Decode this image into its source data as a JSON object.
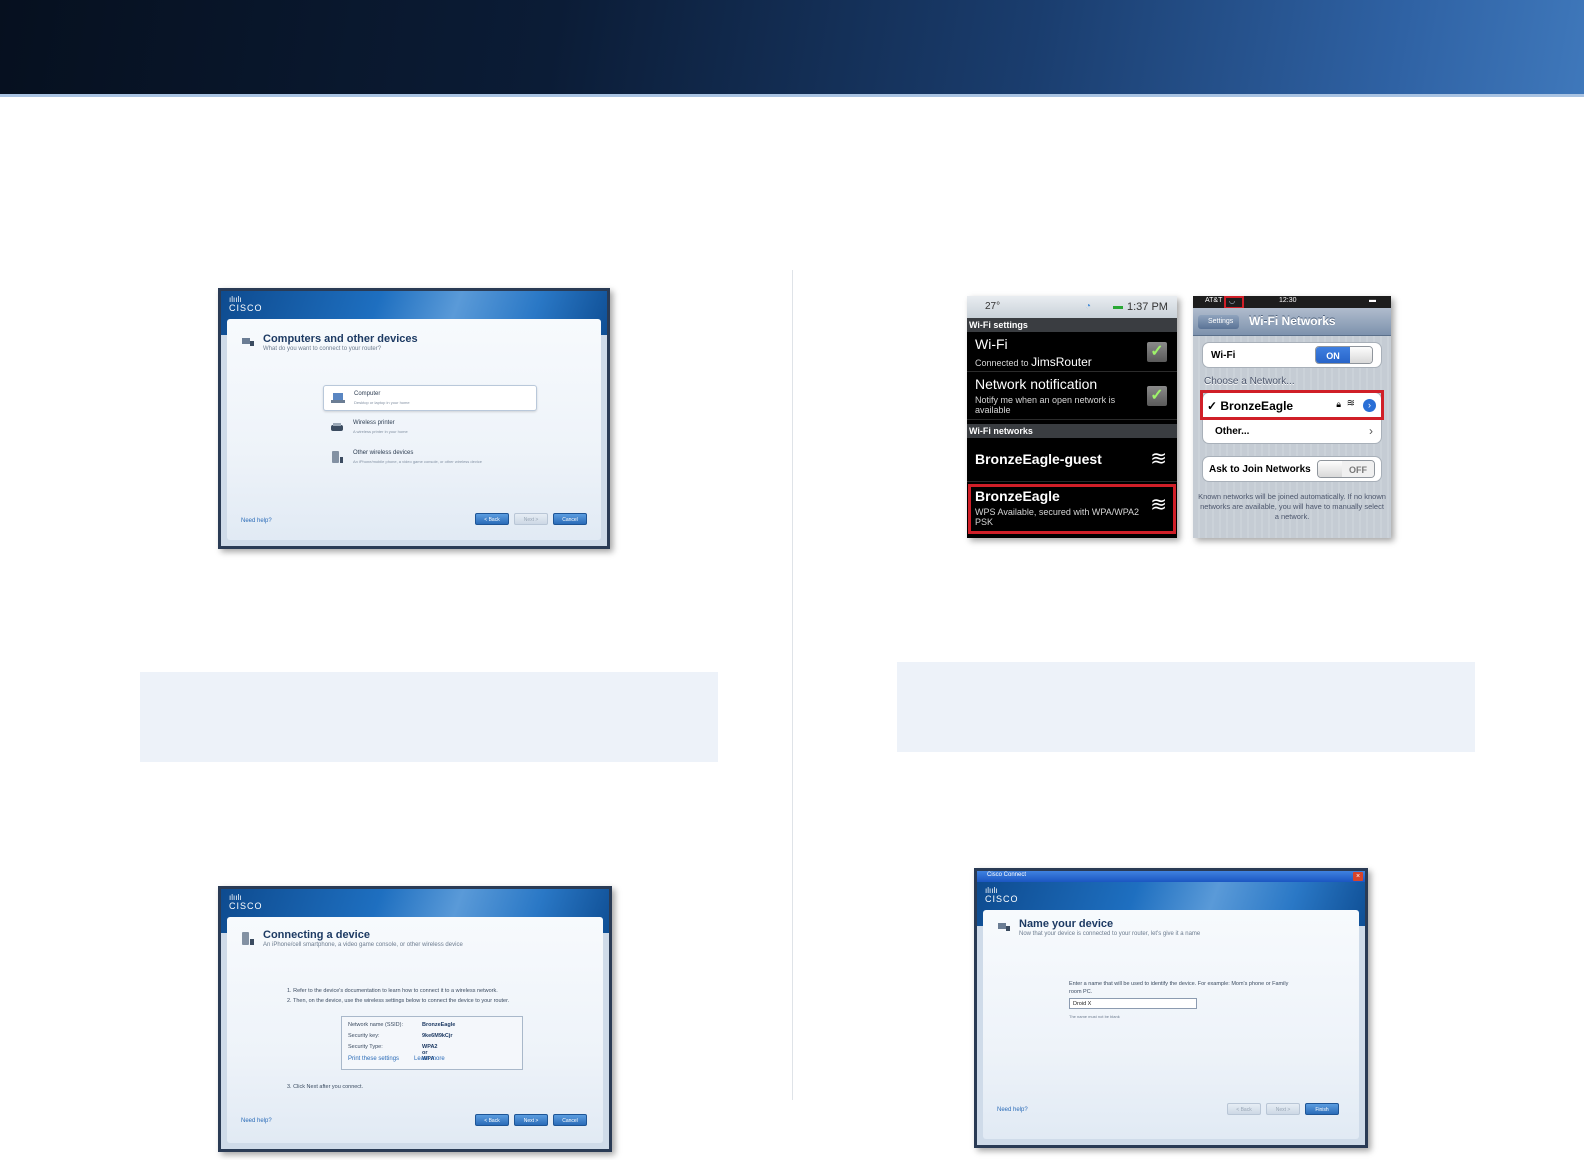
{
  "window_left": {
    "title": "Computers and other devices",
    "subtitle": "What do you want to connect to your router?",
    "options": [
      {
        "title": "Computer",
        "desc": "Desktop or laptop in your home"
      },
      {
        "title": "Wireless printer",
        "desc": "A wireless printer in your home"
      },
      {
        "title": "Other wireless devices",
        "desc": "An iPhone/mobile phone, a video game console, or other wireless device"
      }
    ],
    "help": "Need help?",
    "buttons": {
      "back": "< Back",
      "next": "Next >",
      "cancel": "Cancel"
    }
  },
  "window_connect": {
    "title": "Connecting a device",
    "subtitle": "An iPhone/cell smartphone, a video game console, or other wireless device",
    "steps": [
      "1.  Refer to the device's documentation to learn how to connect it to a wireless network.",
      "2.  Then, on the device, use the wireless settings below to connect the device to your router.",
      "3.  Click Next after you connect."
    ],
    "info": [
      {
        "label": "Network name (SSID):",
        "value": "BronzeEagle"
      },
      {
        "label": "Security key:",
        "value": "9ke6M9kCjr"
      },
      {
        "label": "Security Type:",
        "value": "WPA2 or WPA"
      }
    ],
    "links": {
      "print": "Print these settings",
      "learn": "Learn more"
    },
    "help": "Need help?",
    "buttons": {
      "back": "< Back",
      "next": "Next >",
      "cancel": "Cancel"
    }
  },
  "android": {
    "status_temp": "27°",
    "status_time": "1:37 PM",
    "section_settings": "Wi-Fi settings",
    "wifi_title": "Wi-Fi",
    "wifi_sub_prefix": "Connected to",
    "wifi_sub_network": "JimsRouter",
    "notify_title": "Network notification",
    "notify_sub": "Notify me when an open network is available",
    "section_networks": "Wi-Fi networks",
    "networks": [
      {
        "name": "BronzeEagle-guest",
        "sub": ""
      },
      {
        "name": "BronzeEagle",
        "sub": "WPS Available, secured with WPA/WPA2 PSK"
      }
    ]
  },
  "iphone": {
    "carrier": "AT&T",
    "time": "12:30",
    "back": "Settings",
    "title": "Wi-Fi Networks",
    "wifi_label": "Wi-Fi",
    "wifi_state": "ON",
    "choose": "Choose a Network...",
    "network_selected": "✓ BronzeEagle",
    "other": "Other...",
    "ask_label": "Ask to Join Networks",
    "ask_state": "OFF",
    "footnote": "Known networks will be joined automatically. If no known networks are available, you will have to manually select a network."
  },
  "window_name": {
    "bar": "Cisco Connect",
    "title": "Name your device",
    "subtitle": "Now that your device is connected to your router, let's give it a name",
    "prompt": "Enter a name that will be used to identify the device. For example: Mom's phone or Family room PC.",
    "input_value": "Droid X",
    "hint": "The name must not be blank",
    "help": "Need help?",
    "buttons": {
      "back": "< Back",
      "next": "Next >",
      "finish": "Finish"
    }
  },
  "colors": {
    "highlight": "#d01f28",
    "cisco_blue": "#2b6cb8"
  }
}
